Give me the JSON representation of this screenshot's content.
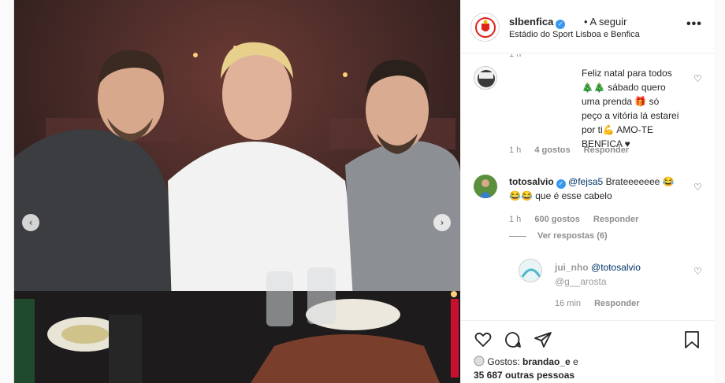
{
  "post": {
    "username": "slbenfica",
    "follow_label": "A seguir",
    "location": "Estádio do Sport Lisboa e Benfica",
    "more_label": "•••",
    "prev_label": "‹",
    "next_label": "›"
  },
  "comments": {
    "cut_time": "1 h",
    "c1": {
      "text": "Feliz natal para todos 🎄🎄 sábado quero uma prenda 🎁 só peço a vitória lá estarei por ti💪 AMO-TE BENFICA ♥",
      "time": "1 h",
      "likes": "4 gostos",
      "reply": "Responder"
    },
    "c2": {
      "username": "totosalvio",
      "mention": "@fejsa5",
      "text": "Brateeeeeee 😂😂😂 que é esse cabelo",
      "time": "1 h",
      "likes": "600 gostos",
      "reply": "Responder",
      "view_replies": "Ver respostas (6)"
    },
    "c3": {
      "username": "jui_nho",
      "mention": "@totosalvio",
      "text": "@g__arosta",
      "time": "16 min",
      "reply": "Responder"
    }
  },
  "likes": {
    "prefix": "Gostos:",
    "text": "35 687 outras pessoas",
    "names": "brandao_e"
  },
  "colors": {
    "accent": "#3897f0",
    "benfica_red": "#e2231a"
  },
  "icons": [
    "heart-icon",
    "comment-icon",
    "share-icon",
    "bookmark-icon"
  ]
}
